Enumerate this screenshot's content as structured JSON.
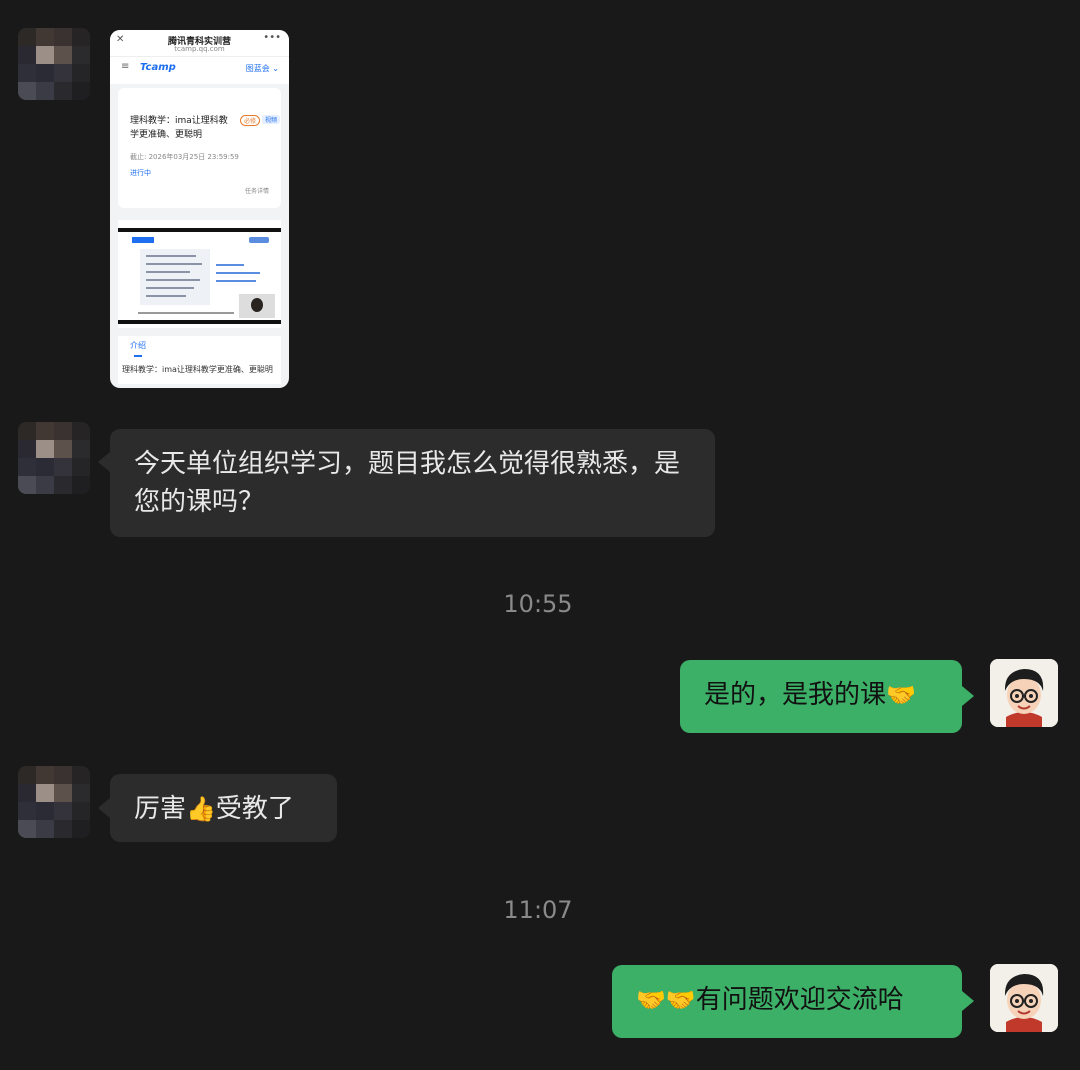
{
  "messages": {
    "incoming_image": {
      "browser_title": "腾讯青科实训营",
      "browser_url": "tcamp.qq.com",
      "close_glyph": "✕",
      "more_glyph": "•••",
      "menu_glyph": "≡",
      "logo_text": "Tcamp",
      "nav_right": "图蓝会 ⌄",
      "task_title": "理科教学：ima让理科教学更准确、更聪明",
      "tag_orange": "必修",
      "tag_blue": "视频",
      "deadline": "截止: 2026年03月25日 23:59:59",
      "status": "进行中",
      "detail_link": "任务详情",
      "intro_tab": "介绍",
      "intro_text": "理科教学：ima让理科教学更准确、更聪明"
    },
    "incoming_1": "今天单位组织学习，题目我怎么觉得很熟悉，是您的课吗？",
    "time_1": "10:55",
    "outgoing_1_text": "是的，是我的课",
    "outgoing_1_emoji": "🤝",
    "incoming_2_pre": "厉害",
    "incoming_2_emoji": "👍",
    "incoming_2_post": "受教了",
    "time_2": "11:07",
    "outgoing_2_emoji": "🤝🤝",
    "outgoing_2_text": "有问题欢迎交流哈"
  },
  "colors": {
    "background": "#191919",
    "incoming_bubble": "#2c2c2c",
    "outgoing_bubble": "#3db068",
    "timestamp": "#8a8a8a"
  }
}
